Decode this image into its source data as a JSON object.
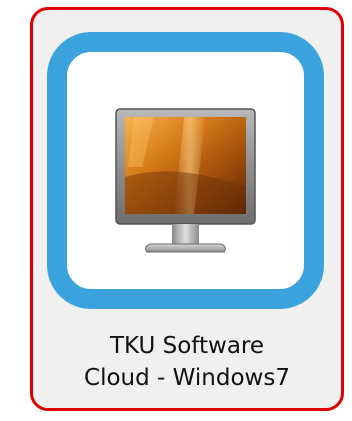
{
  "shortcut": {
    "label_line1": "TKU Software",
    "label_line2": "Cloud - Windows7",
    "icon": "monitor-icon"
  },
  "colors": {
    "selection_border": "#e00000",
    "tile_border": "#3aa2dd",
    "tile_background": "#ffffff",
    "shortcut_background": "#f0f0f0"
  }
}
